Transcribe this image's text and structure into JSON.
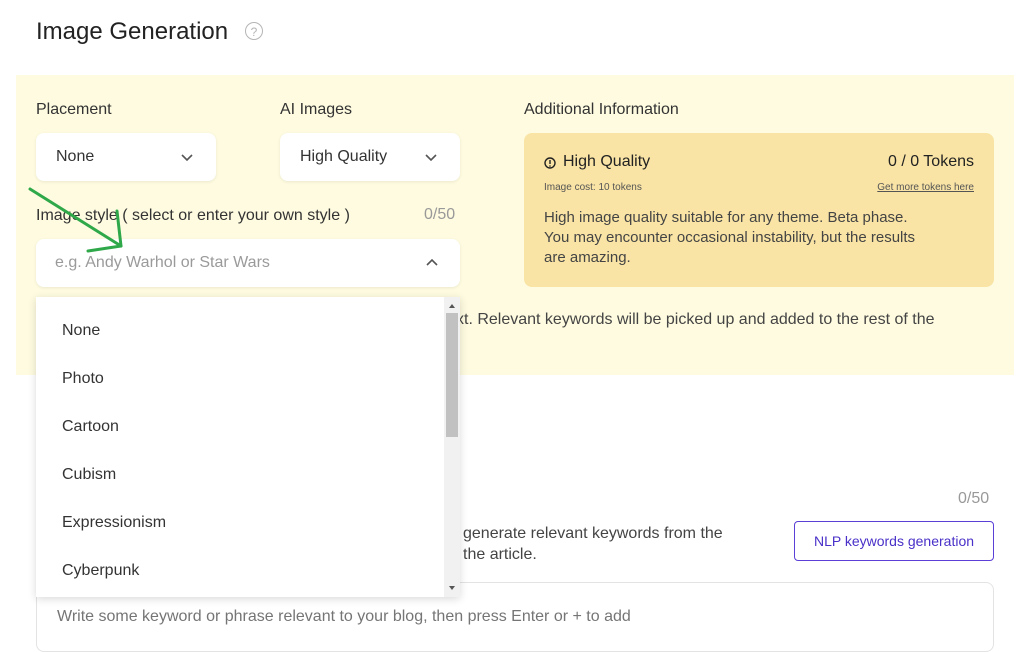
{
  "page": {
    "title": "Image Generation",
    "help_glyph": "?"
  },
  "placement": {
    "label": "Placement",
    "value": "None"
  },
  "ai_images": {
    "label": "AI Images",
    "value": "High Quality"
  },
  "additional_info": {
    "label": "Additional Information",
    "quality_title": "High Quality",
    "tokens": "0 / 0 Tokens",
    "image_cost": "Image cost: 10 tokens",
    "get_tokens_link": "Get more tokens here",
    "description_line1": "High image quality suitable for any theme. Beta phase.",
    "description_line2": "You may encounter occasional instability, but the results",
    "description_line3": "are amazing."
  },
  "image_style": {
    "label": "Image style ( select or enter your own style )",
    "counter": "0/50",
    "placeholder": "e.g. Andy Warhol or Star Wars",
    "options": [
      "None",
      "Photo",
      "Cartoon",
      "Cubism",
      "Expressionism",
      "Cyberpunk"
    ]
  },
  "hidden_behind_dropdown": {
    "keywords_note": "xt. Relevant keywords will be picked up and added to the rest of the"
  },
  "keywords": {
    "counter": "0/50",
    "nlp_text_line1": "generate relevant keywords from the",
    "nlp_text_line2": "the article.",
    "nlp_button": "NLP keywords generation",
    "input_placeholder": "Write some keyword or phrase relevant to your blog, then press Enter or + to add"
  },
  "colors": {
    "panel_bg": "#fefbe0",
    "info_bg": "#f9e4a5",
    "accent": "#5b3fd6",
    "annotation_arrow": "#2fa84a"
  }
}
